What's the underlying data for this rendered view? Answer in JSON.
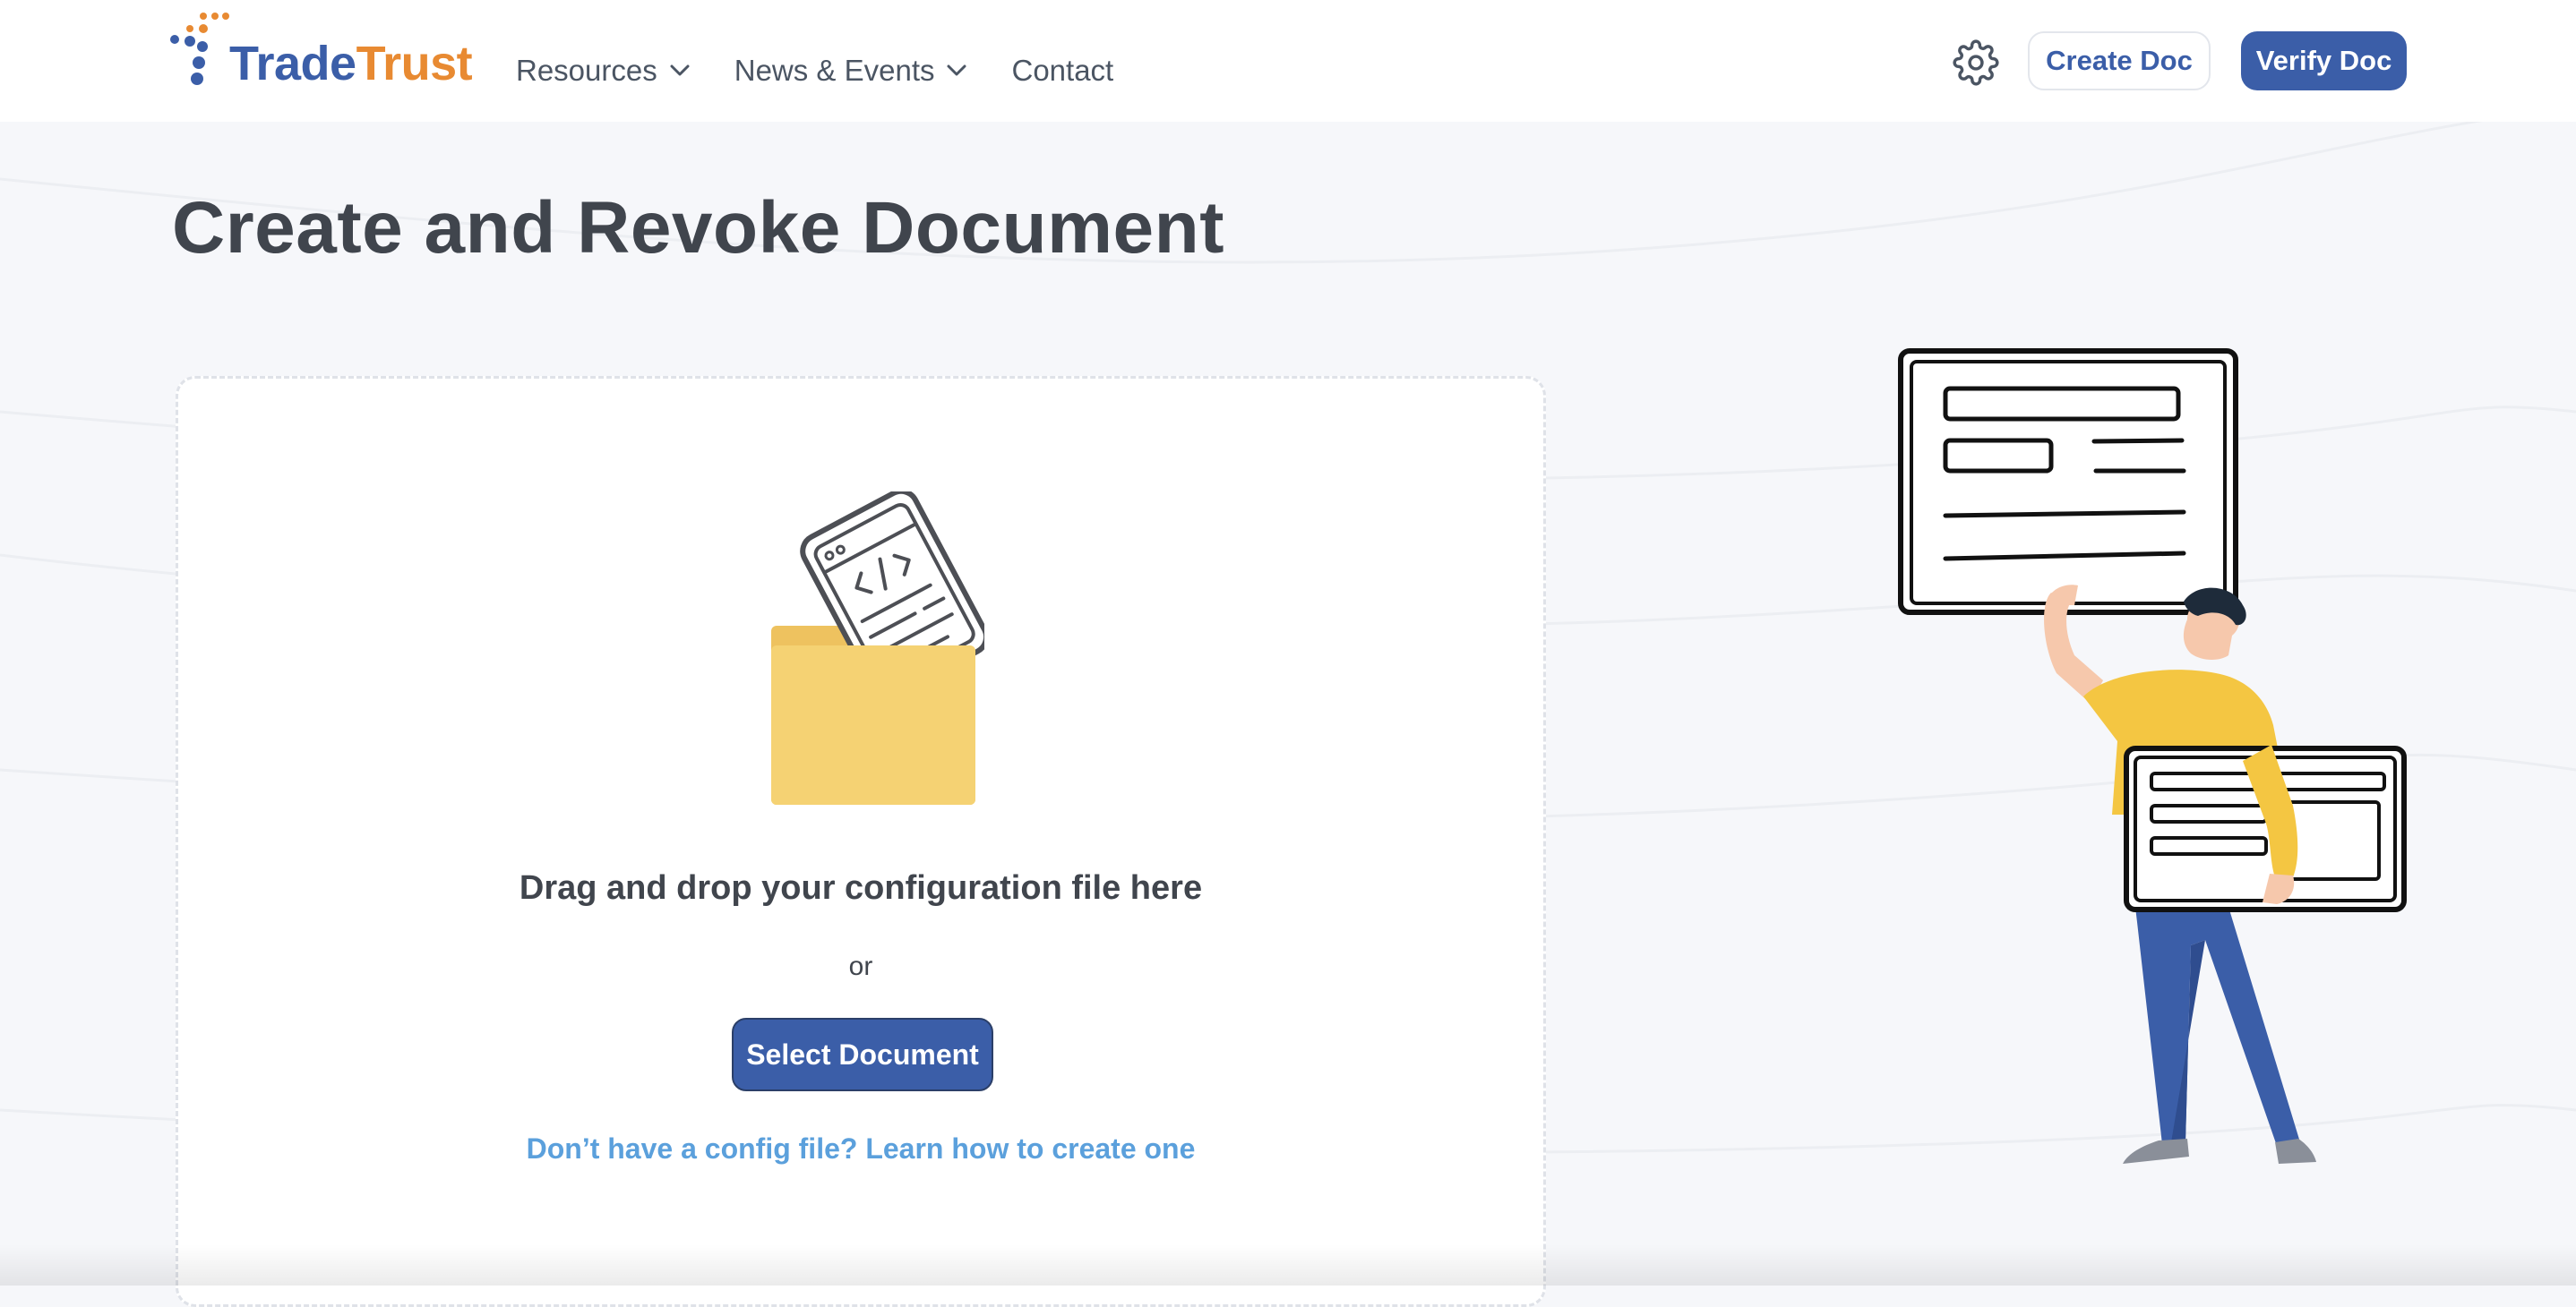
{
  "header": {
    "logo": {
      "part1": "Trade",
      "part2": "Trust"
    },
    "nav": [
      {
        "label": "Resources",
        "has_dropdown": true
      },
      {
        "label": "News & Events",
        "has_dropdown": true
      },
      {
        "label": "Contact",
        "has_dropdown": false
      }
    ],
    "settings_icon": "gear-icon",
    "create_doc_label": "Create Doc",
    "verify_doc_label": "Verify Doc"
  },
  "main": {
    "title": "Create and Revoke Document",
    "dropzone": {
      "instruction": "Drag and drop your configuration file here",
      "or": "or",
      "select_button": "Select Document",
      "help_link": "Don’t have a config file? Learn how to create one"
    }
  },
  "colors": {
    "brand_blue": "#3b5ea8",
    "brand_orange": "#e88a32",
    "link_blue": "#5ba0dc",
    "text_dark": "#40454d",
    "folder_yellow": "#f5d273"
  }
}
